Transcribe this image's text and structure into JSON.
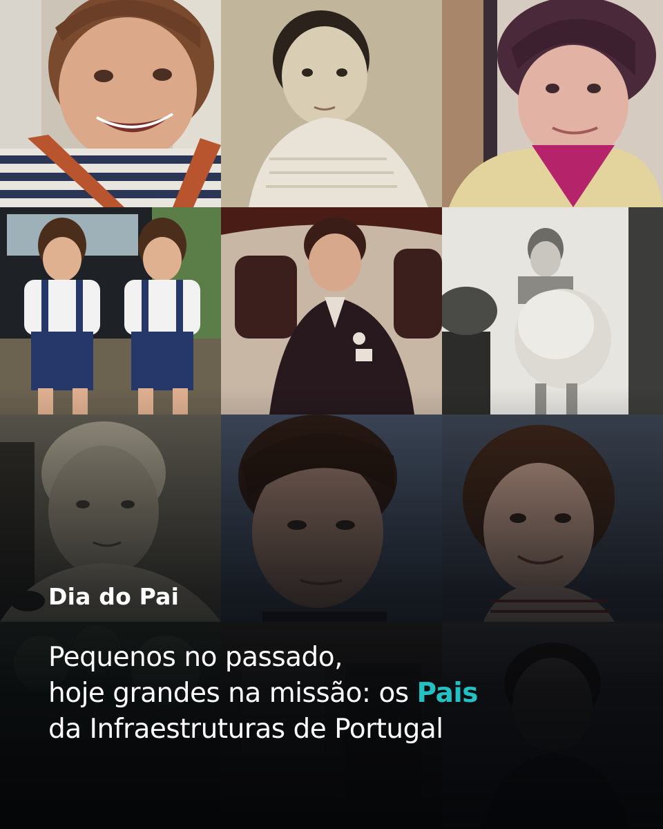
{
  "post": {
    "kicker": "Dia do Pai",
    "headline": {
      "line1": "Pequenos no passado,",
      "line2_before": "hoje grandes na missão: os ",
      "line2_highlight": "Pais",
      "line3": "da Infraestruturas de Portugal"
    }
  },
  "colors": {
    "highlight": "#22c1c3",
    "text": "#ffffff",
    "background": "#0b0d10"
  }
}
